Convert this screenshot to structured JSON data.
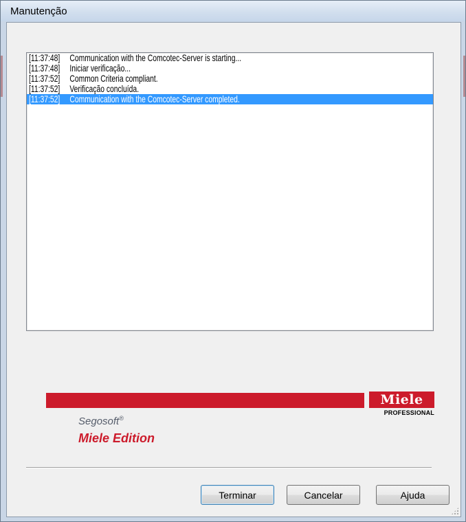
{
  "window": {
    "title": "Manutenção"
  },
  "log": {
    "entries": [
      {
        "time": "[11:37:48]",
        "message": "Communication with the Comcotec-Server is starting...",
        "selected": false
      },
      {
        "time": "[11:37:48]",
        "message": "Iniciar verificação...",
        "selected": false
      },
      {
        "time": "[11:37:52]",
        "message": "Common Criteria compliant.",
        "selected": false
      },
      {
        "time": "[11:37:52]",
        "message": "Verificação concluída.",
        "selected": false
      },
      {
        "time": "[11:37:52]",
        "message": "Communication with the Comcotec-Server completed.",
        "selected": true
      }
    ]
  },
  "branding": {
    "logo_text": "Miele",
    "logo_subtext": "PROFESSIONAL",
    "product_name": "Segosoft",
    "product_mark": "®",
    "edition": "Miele Edition",
    "brand_color": "#cc1b2b"
  },
  "buttons": {
    "finish": "Terminar",
    "cancel": "Cancelar",
    "help": "Ajuda"
  }
}
